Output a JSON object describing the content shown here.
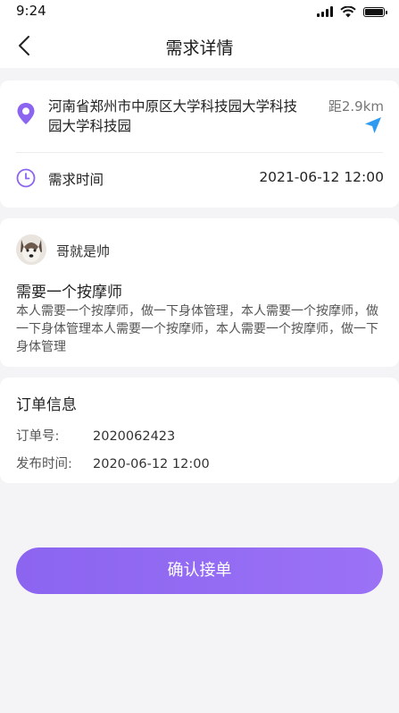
{
  "status_bar": {
    "time": "9:24"
  },
  "nav": {
    "title": "需求详情"
  },
  "address": {
    "text": "河南省郑州市中原区大学科技园大学科技园大学科技园",
    "distance": "距2.9km",
    "time_label": "需求时间",
    "time_value": "2021-06-12 12:00"
  },
  "demand": {
    "user_name": "哥就是帅",
    "title": "需要一个按摩师",
    "description": "本人需要一个按摩师，做一下身体管理，本人需要一个按摩师，做一下身体管理本人需要一个按摩师，本人需要一个按摩师，做一下身体管理"
  },
  "order": {
    "title": "订单信息",
    "number_label": "订单号:",
    "number_value": "2020062423",
    "publish_label": "发布时间:",
    "publish_value": "2020-06-12 12:00"
  },
  "actions": {
    "confirm_label": "确认接单"
  },
  "colors": {
    "accent": "#8b64f0",
    "nav_arrow": "#2f9bf0"
  },
  "icons": [
    "back-icon",
    "location-pin-icon",
    "navigation-arrow-icon",
    "clock-icon",
    "avatar"
  ]
}
